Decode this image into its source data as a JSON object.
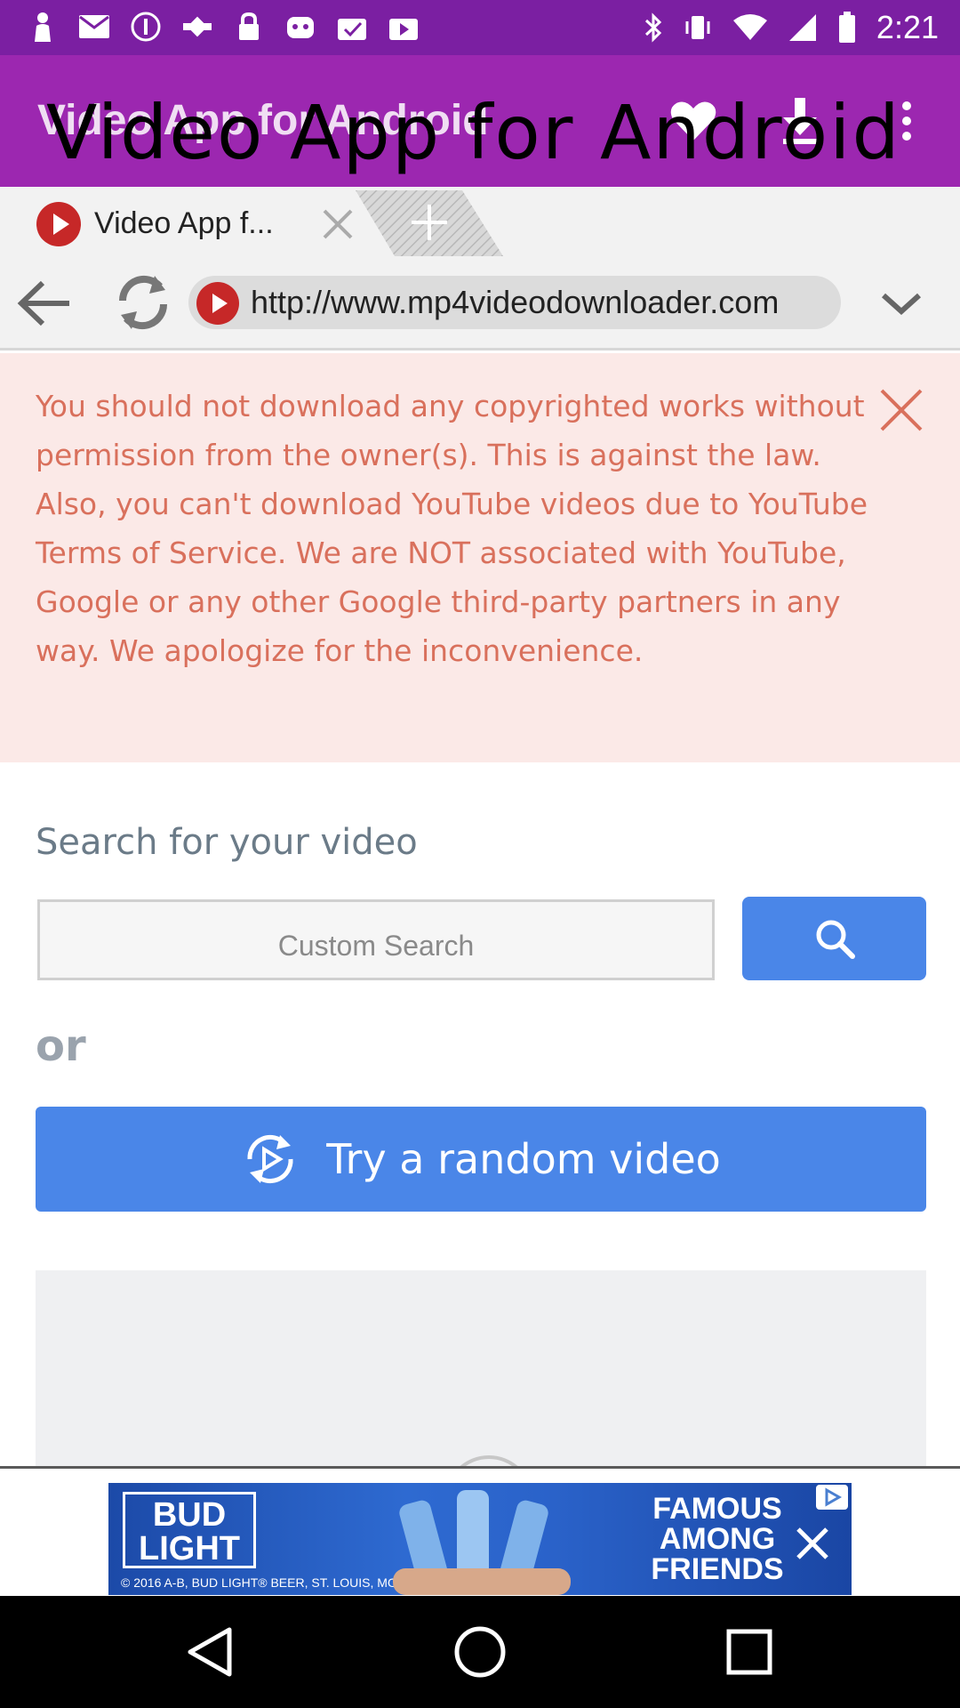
{
  "status_bar": {
    "time": "2:21",
    "left_icons": [
      "person-icon",
      "mail-icon",
      "info-icon",
      "fake-gps-icon",
      "lock-icon",
      "android-icon",
      "checkmark-bag-icon",
      "video-bag-icon"
    ],
    "right_icons": [
      "bluetooth-icon",
      "vibrate-icon",
      "wifi-icon",
      "signal-icon",
      "battery-icon"
    ]
  },
  "app_bar": {
    "title": "Video App for Android",
    "overlay_title": "Video App for Android",
    "actions": [
      "heart-icon",
      "download-icon",
      "more-vert-icon"
    ]
  },
  "tabs": {
    "active_tab_title": "Video App f...",
    "close_icon": "close-icon",
    "new_tab_icon": "plus-icon"
  },
  "address_bar": {
    "url": "http://www.mp4videodownloader.com",
    "back_icon": "arrow-left-icon",
    "refresh_icon": "refresh-icon",
    "menu_icon": "chevron-down-icon"
  },
  "warning": {
    "text": "You should not download any copyrighted works without permission from the owner(s). This is against the law. Also, you can't download YouTube videos due to YouTube Terms of Service. We are NOT associated with YouTube, Google or any other Google third-party partners in any way. We apologize for the inconvenience."
  },
  "search": {
    "heading": "Search for your video",
    "placeholder": "Custom Search",
    "or_label": "or",
    "random_label": "Try a random video"
  },
  "ad": {
    "brand_line1": "BUD",
    "brand_line2": "LIGHT",
    "fine_print": "© 2016 A-B, BUD LIGHT® BEER, ST. LOUIS, MO",
    "slogan_line1": "FAMOUS",
    "slogan_line2": "AMONG",
    "slogan_line3": "FRIENDS"
  },
  "colors": {
    "status_bar": "#7b1fa2",
    "app_bar": "#9c27b0",
    "accent_blue": "#4a86e8",
    "warning_bg": "#fbe9e7",
    "warning_text": "#d9705c"
  }
}
